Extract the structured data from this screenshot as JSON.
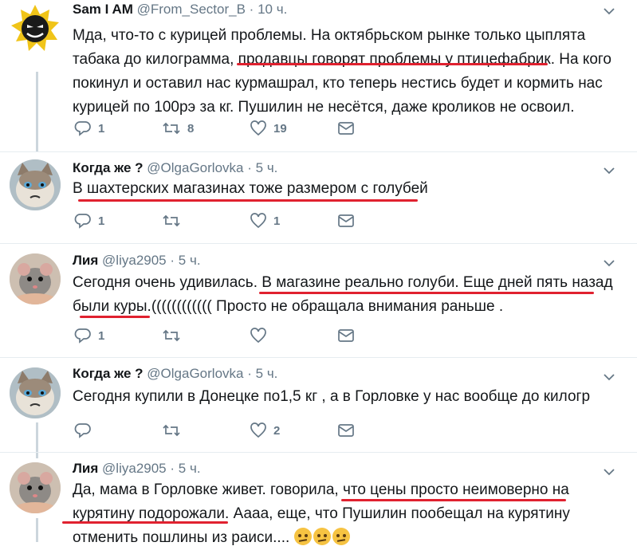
{
  "tweets": [
    {
      "name": "Sam I AM",
      "handle": "@From_Sector_B",
      "sep": "·",
      "time": "10 ч.",
      "lines": [
        "Мда, что-то с курицей проблемы. На октябрьском рынке только цыплята",
        "табака до килограмма, продавцы говорят проблемы у птицефабрик. На кого",
        "покинул и оставил нас курмашрал, кто теперь нестись будет и кормить нас",
        "курицей по 100рэ за кг. Пушилин не несётся, даже кроликов не освоил."
      ],
      "reply_count": "1",
      "retweet_count": "8",
      "like_count": "19"
    },
    {
      "name": "Когда же ?",
      "handle": "@OlgaGorlovka",
      "sep": "·",
      "time": "5 ч.",
      "lines": [
        "В шахтерских магазинах тоже размером с голубей"
      ],
      "reply_count": "1",
      "retweet_count": "",
      "like_count": "1"
    },
    {
      "name": "Лия",
      "handle": "@liya2905",
      "sep": "·",
      "time": "5 ч.",
      "lines": [
        "Сегодня очень удивилась.  В магазине реально голуби. Еще дней пять назад",
        "были куры.(((((((((((( Просто не обращала внимания раньше ."
      ],
      "reply_count": "1",
      "retweet_count": "",
      "like_count": ""
    },
    {
      "name": "Когда же ?",
      "handle": "@OlgaGorlovka",
      "sep": "·",
      "time": "5 ч.",
      "lines": [
        "Сегодня купили в Донецке по1,5 кг , а в Горловке у нас вообще до килогр"
      ],
      "reply_count": "",
      "retweet_count": "",
      "like_count": "2"
    },
    {
      "name": "Лия",
      "handle": "@liya2905",
      "sep": "·",
      "time": "5 ч.",
      "lines": [
        "Да, мама в Горловке живет. говорила, что цены просто неимоверно на",
        "курятину подорожали. Аааа, еще, что Пушилин пообещал на курятину",
        "отменить пошлины из раиси...."
      ],
      "reply_count": "",
      "retweet_count": "",
      "like_count": ""
    }
  ],
  "icons": [
    "chevron-down-icon",
    "reply-icon",
    "retweet-icon",
    "like-icon",
    "message-icon",
    "thinking-face-emoji"
  ],
  "colors": {
    "underline": "#e0212f",
    "meta": "#657786",
    "thread_line": "#ccd6dd",
    "separator": "#e6ecf0"
  }
}
